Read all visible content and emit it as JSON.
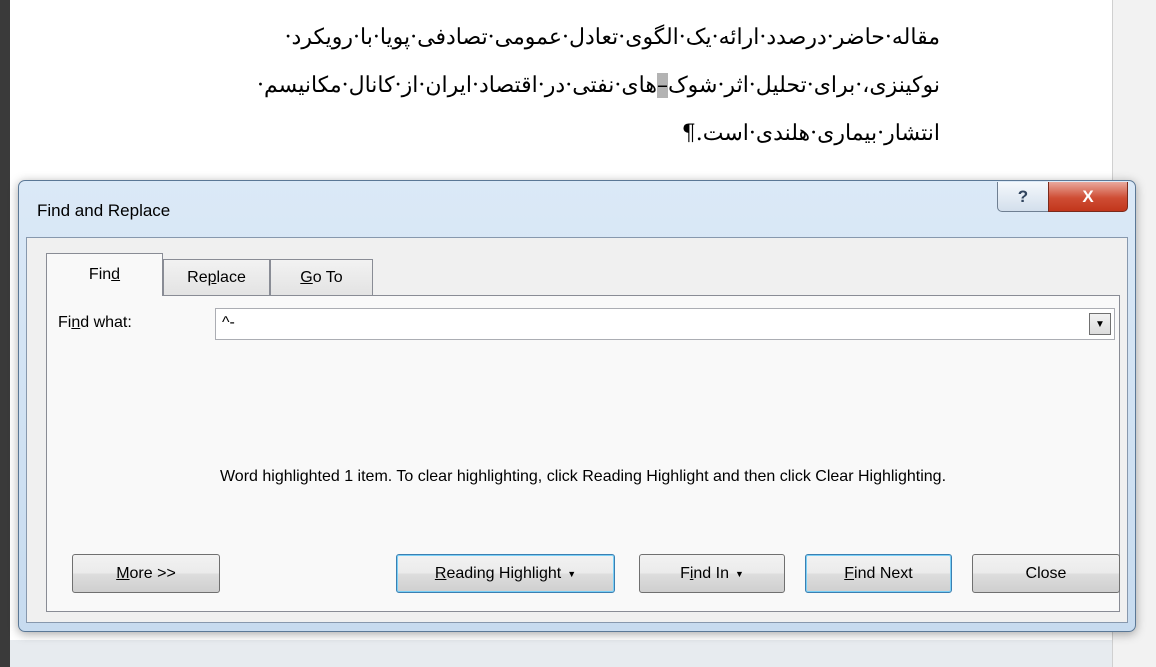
{
  "document": {
    "lines": [
      "مقاله·حاضر·درصدد·ارائه·یک·الگوی·تعادل·عمومی·تصادفی·پویا·با·رویکرد·",
      "نوکینزی،·برای·تحلیل·اثر·شوک–های·نفتی·در·اقتصاد·ایران·از·کانال·مکانیسم·",
      "انتشار·بیماری·هلندی·است.¶"
    ],
    "line2_before_highlight": "نوکینزی،·برای·تحلیل·اثر·شوک",
    "line2_highlight": "–",
    "line2_after_highlight": "های·نفتی·در·اقتصاد·ایران·از·کانال·مکانیسم·"
  },
  "dialog": {
    "title": "Find and Replace",
    "help_glyph": "?",
    "close_glyph": "X",
    "tabs": [
      {
        "label_pre": "Fin",
        "label_key": "d",
        "label_post": ""
      },
      {
        "label_pre": "Re",
        "label_key": "p",
        "label_post": "lace"
      },
      {
        "label_pre": "",
        "label_key": "G",
        "label_post": "o To"
      }
    ],
    "find_what_label_pre": "Fi",
    "find_what_label_key": "n",
    "find_what_label_post": "d what:",
    "find_what_value": "^-",
    "status_message": "Word highlighted 1 item. To clear highlighting, click Reading Highlight and then click Clear Highlighting.",
    "buttons": {
      "more": {
        "pre": "",
        "key": "M",
        "post": "ore >>"
      },
      "reading_highlight": {
        "pre": "",
        "key": "R",
        "post": "eading Highlight"
      },
      "find_in": {
        "pre": "F",
        "key": "i",
        "post": "nd In"
      },
      "find_next": {
        "pre": "",
        "key": "F",
        "post": "ind Next"
      },
      "close": {
        "label": "Close"
      }
    }
  },
  "colors": {
    "highlight": "#b3b3b3",
    "dialog_frame": "#c7dbef",
    "close_button": "#c2361c"
  }
}
